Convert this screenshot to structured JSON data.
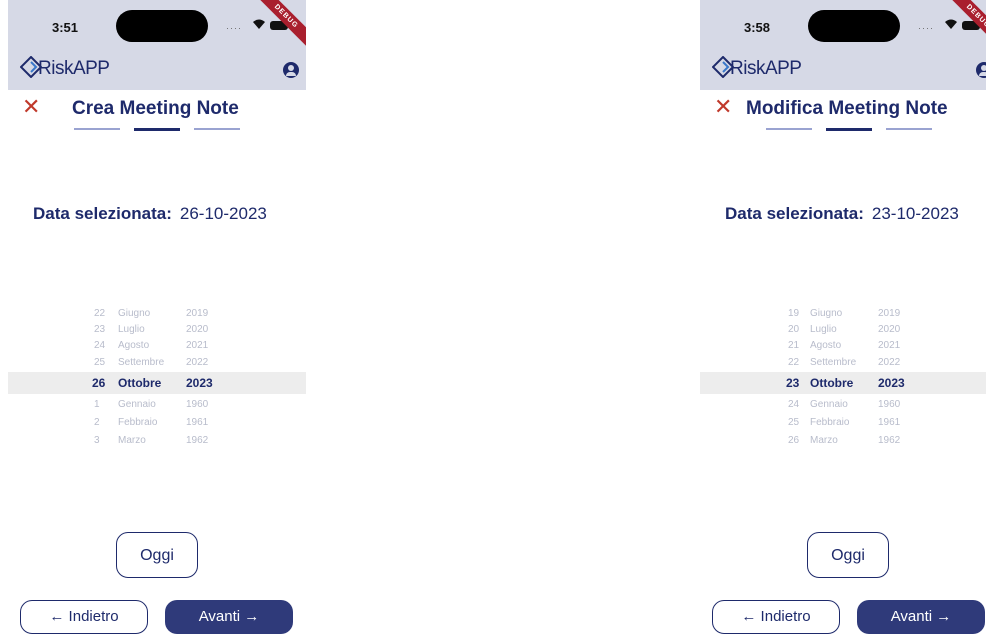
{
  "screens": [
    {
      "status_time": "3:51",
      "debug_label": "DEBUG",
      "app_name": "RiskAPP",
      "page_title": "Crea Meeting Note",
      "date_label": "Data selezionata:",
      "date_value": "26-10-2023",
      "picker_rows": [
        {
          "day": "22",
          "month": "Giugno",
          "year": "2019"
        },
        {
          "day": "23",
          "month": "Luglio",
          "year": "2020"
        },
        {
          "day": "24",
          "month": "Agosto",
          "year": "2021"
        },
        {
          "day": "25",
          "month": "Settembre",
          "year": "2022"
        },
        {
          "day": "26",
          "month": "Ottobre",
          "year": "2023"
        },
        {
          "day": "1",
          "month": "Gennaio",
          "year": "1960"
        },
        {
          "day": "2",
          "month": "Febbraio",
          "year": "1961"
        },
        {
          "day": "3",
          "month": "Marzo",
          "year": "1962"
        }
      ],
      "today_button": "Oggi",
      "back_button": "← Indietro",
      "next_button": "Avanti →"
    },
    {
      "status_time": "3:58",
      "debug_label": "DEBUG",
      "app_name": "RiskAPP",
      "page_title": "Modifica Meeting Note",
      "date_label": "Data selezionata:",
      "date_value": "23-10-2023",
      "picker_rows": [
        {
          "day": "19",
          "month": "Giugno",
          "year": "2019"
        },
        {
          "day": "20",
          "month": "Luglio",
          "year": "2020"
        },
        {
          "day": "21",
          "month": "Agosto",
          "year": "2021"
        },
        {
          "day": "22",
          "month": "Settembre",
          "year": "2022"
        },
        {
          "day": "23",
          "month": "Ottobre",
          "year": "2023"
        },
        {
          "day": "24",
          "month": "Gennaio",
          "year": "1960"
        },
        {
          "day": "25",
          "month": "Febbraio",
          "year": "1961"
        },
        {
          "day": "26",
          "month": "Marzo",
          "year": "1962"
        }
      ],
      "today_button": "Oggi",
      "back_button": "← Indietro",
      "next_button": "Avanti →"
    }
  ],
  "colors": {
    "primary": "#1e2a6b",
    "appbar": "#d6d9e6",
    "close": "#c0392b",
    "debug": "#a91f2e",
    "next_button_bg": "#2f3a7a"
  },
  "icons": [
    "riskapp-logo-icon",
    "account-icon",
    "close-icon",
    "wifi-icon",
    "battery-icon"
  ]
}
